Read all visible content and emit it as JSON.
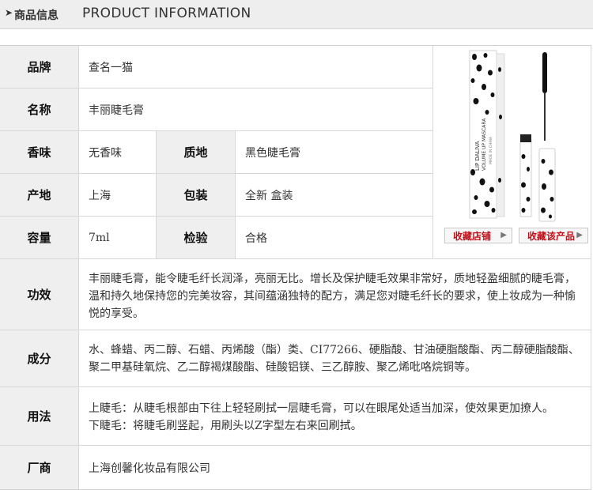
{
  "header": {
    "arrow": "➤",
    "title_cn": "商品信息",
    "title_en": "PRODUCT INFORMATION"
  },
  "rows": {
    "brand": {
      "label": "品牌",
      "value": "查名一猫"
    },
    "name": {
      "label": "名称",
      "value": "丰丽睫毛膏"
    },
    "scent": {
      "label": "香味",
      "value": "无香味"
    },
    "texture": {
      "label": "质地",
      "value": "黑色睫毛膏"
    },
    "origin": {
      "label": "产地",
      "value": "上海"
    },
    "package": {
      "label": "包装",
      "value": "全新 盒装"
    },
    "capacity": {
      "label": "容量",
      "value": "7ml"
    },
    "inspection": {
      "label": "检验",
      "value": "合格"
    },
    "effect": {
      "label": "功效",
      "value": "丰丽睫毛膏，能令睫毛纤长润泽，亮丽无比。增长及保护睫毛效果非常好，质地轻盈细腻的睫毛膏，温和持久地保持您的完美妆容，其间蕴涵独特的配方，满足您对睫毛纤长的要求，使上妆成为一种愉悦的享受。"
    },
    "ingredients": {
      "label": "成分",
      "value": "水、蜂蜡、丙二醇、石蜡、丙烯酸（酯）类、CI77266、硬脂酸、甘油硬脂酸酯、丙二醇硬脂酸酯、聚二甲基硅氧烷、乙二醇褐煤酸酯、硅酸铝镁、三乙醇胺、聚乙烯吡咯烷铜等。"
    },
    "usage": {
      "label": "用法",
      "line1": "上睫毛：从睫毛根部由下往上轻轻刷拭一层睫毛膏，可以在眼尾处适当加深，使效果更加撩人。",
      "line2": "下睫毛：将睫毛刷竖起，用刷头以Z字型左右来回刷拭。"
    },
    "maker": {
      "label": "厂商",
      "value": "上海创馨化妆品有限公司"
    }
  },
  "product_image": {
    "box_text_1": "LIP DALIVA",
    "box_text_2": "VOLUME UP MASCARA",
    "box_text_3": "MADE IN CHINA"
  },
  "buttons": {
    "fav_store": "收藏店铺",
    "fav_product": "收藏该产品"
  },
  "colors": {
    "label_bg": "#efefef",
    "accent_red": "#c0101a"
  }
}
